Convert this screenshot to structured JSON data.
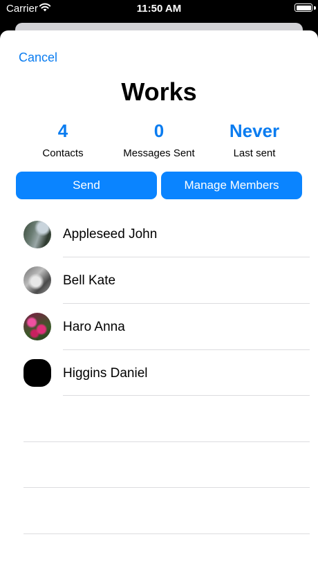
{
  "status": {
    "carrier": "Carrier",
    "time": "11:50 AM"
  },
  "nav": {
    "cancel_label": "Cancel"
  },
  "group": {
    "title": "Works"
  },
  "stats": [
    {
      "value": "4",
      "label": "Contacts"
    },
    {
      "value": "0",
      "label": "Messages Sent"
    },
    {
      "value": "Never",
      "label": "Last sent"
    }
  ],
  "actions": {
    "send_label": "Send",
    "manage_label": "Manage Members"
  },
  "members": [
    {
      "name": "Appleseed John",
      "avatar": "waterfall-photo"
    },
    {
      "name": "Bell Kate",
      "avatar": "hand-photo"
    },
    {
      "name": "Haro Anna",
      "avatar": "flowers-photo"
    },
    {
      "name": "Higgins Daniel",
      "avatar": "blank-photo"
    }
  ],
  "colors": {
    "accent": "#0a84ff",
    "link": "#0a7cf0",
    "separator": "#dcdcdf"
  }
}
